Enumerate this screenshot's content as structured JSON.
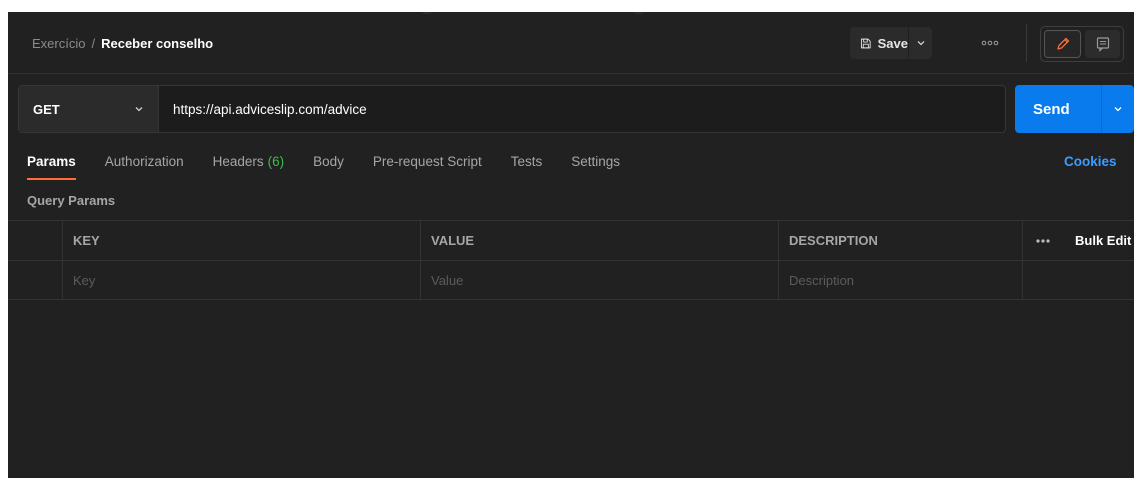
{
  "breadcrumb": {
    "parent": "Exercício",
    "separator": "/",
    "current": "Receber conselho"
  },
  "toolbar": {
    "save_label": "Save",
    "save_icon": "floppy-icon",
    "save_caret_icon": "chevron-down-icon",
    "more_icon": "ellipsis-icon",
    "edit_icon": "pencil-icon",
    "comment_icon": "comment-icon"
  },
  "request": {
    "method": "GET",
    "url": "https://api.adviceslip.com/advice",
    "send_label": "Send"
  },
  "tabs": [
    {
      "label": "Params",
      "active": true
    },
    {
      "label": "Authorization"
    },
    {
      "label": "Headers",
      "count": "(6)"
    },
    {
      "label": "Body"
    },
    {
      "label": "Pre-request Script"
    },
    {
      "label": "Tests"
    },
    {
      "label": "Settings"
    }
  ],
  "cookies_label": "Cookies",
  "query_params": {
    "title": "Query Params",
    "columns": {
      "key": "KEY",
      "value": "VALUE",
      "description": "DESCRIPTION"
    },
    "bulk_edit_label": "Bulk Edit",
    "placeholders": {
      "key": "Key",
      "value": "Value",
      "description": "Description"
    }
  },
  "colors": {
    "accent_tab": "#ff6c37",
    "send_button": "#097bed",
    "cookies_link": "#3d9cff",
    "header_count": "#3fb950",
    "edit_icon": "#ff6c37"
  }
}
